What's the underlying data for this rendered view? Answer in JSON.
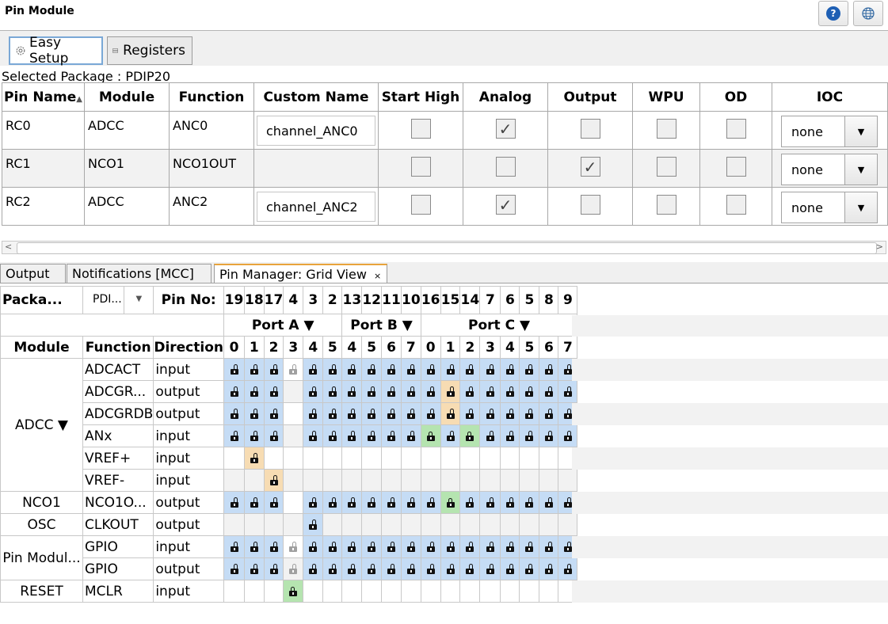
{
  "window": {
    "title": "Pin Module"
  },
  "top_tabs": [
    {
      "label": "Easy Setup",
      "icon": "gear-icon"
    },
    {
      "label": "Registers",
      "icon": "list-icon"
    }
  ],
  "selected_package": "Selected Package : PDIP20",
  "pin_table": {
    "headers": [
      "Pin Name",
      "Module",
      "Function",
      "Custom Name",
      "Start High",
      "Analog",
      "Output",
      "WPU",
      "OD",
      "IOC"
    ],
    "rows": [
      {
        "pin": "RC0",
        "module": "ADCC",
        "function": "ANC0",
        "custom_name": "channel_ANC0",
        "start_high": false,
        "analog": true,
        "output": false,
        "wpu": false,
        "od": false,
        "ioc": "none"
      },
      {
        "pin": "RC1",
        "module": "NCO1",
        "function": "NCO1OUT",
        "custom_name": "",
        "start_high": false,
        "analog": false,
        "output": true,
        "wpu": false,
        "od": false,
        "ioc": "none"
      },
      {
        "pin": "RC2",
        "module": "ADCC",
        "function": "ANC2",
        "custom_name": "channel_ANC2",
        "start_high": false,
        "analog": true,
        "output": false,
        "wpu": false,
        "od": false,
        "ioc": "none"
      }
    ]
  },
  "bottom_tabs": [
    {
      "label": "Output"
    },
    {
      "label": "Notifications [MCC]"
    },
    {
      "label": "Pin Manager: Grid View",
      "close": "×"
    }
  ],
  "grid": {
    "package_label": "Packa...",
    "package_value": "PDI...",
    "pin_no_label": "Pin No:",
    "pin_numbers": [
      "19",
      "18",
      "17",
      "4",
      "3",
      "2",
      "13",
      "12",
      "11",
      "10",
      "16",
      "15",
      "14",
      "7",
      "6",
      "5",
      "8",
      "9"
    ],
    "ports": [
      {
        "label": "Port A ▼"
      },
      {
        "label": "Port B ▼"
      },
      {
        "label": "Port C ▼"
      }
    ],
    "headers": {
      "module": "Module",
      "function": "Function",
      "direction": "Direction"
    },
    "bit_numbers": [
      "0",
      "1",
      "2",
      "3",
      "4",
      "5",
      "4",
      "5",
      "6",
      "7",
      "0",
      "1",
      "2",
      "3",
      "4",
      "5",
      "6",
      "7"
    ],
    "modules": [
      {
        "name": "ADCC ▼",
        "rows": [
          {
            "function": "ADCACT",
            "direction": "input",
            "cells": "BBBGBBBBBBBBBBBBBB"
          },
          {
            "function": "ADCGR...",
            "direction": "output",
            "cells": "BBB.BBBBBBBOBBBBBB"
          },
          {
            "function": "ADCGRDB",
            "direction": "output",
            "cells": "BBB.BBBBBBBOBBBBBB"
          },
          {
            "function": "ANx",
            "direction": "input",
            "cells": "BBB.BBBBBBLBLBBBBB"
          },
          {
            "function": "VREF+",
            "direction": "input",
            "cells": ".O................"
          },
          {
            "function": "VREF-",
            "direction": "input",
            "cells": "..O..............."
          }
        ]
      },
      {
        "name": "NCO1",
        "rows": [
          {
            "function": "NCO1O...",
            "direction": "output",
            "cells": "BBB.BBBBBBBLBBBBBB"
          }
        ]
      },
      {
        "name": "OSC",
        "rows": [
          {
            "function": "CLKOUT",
            "direction": "output",
            "cells": "....B............."
          }
        ]
      },
      {
        "name": "Pin Modul...",
        "rows": [
          {
            "function": "GPIO",
            "direction": "input",
            "cells": "BBBGBBBBBBBBBBBBBB"
          },
          {
            "function": "GPIO",
            "direction": "output",
            "cells": "BBBGBBBBBBBBBBBBBB"
          }
        ]
      },
      {
        "name": "RESET",
        "rows": [
          {
            "function": "MCLR",
            "direction": "input",
            "cells": "...L.............."
          }
        ]
      }
    ],
    "legend": {
      "B": "blue-unlocked",
      "O": "orange-unlocked",
      "L": "green-locked",
      "G": "grey-unlocked",
      ".": "empty"
    }
  },
  "colors": {
    "available": "#c5dcf5",
    "selected": "#f7dcb3",
    "locked": "#b5e4b0",
    "active_tab": "#7aa8d6"
  }
}
